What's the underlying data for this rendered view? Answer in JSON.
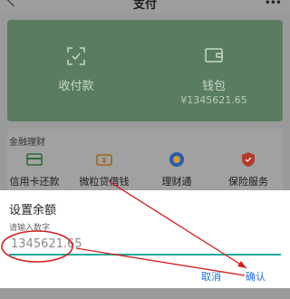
{
  "header": {
    "title": "支付"
  },
  "card": {
    "receive_label": "收付款",
    "wallet_label": "钱包",
    "wallet_amount": "¥1345621.65"
  },
  "finance": {
    "section_title": "金融理财",
    "items": [
      {
        "label": "信用卡还款",
        "icon": "credit-card-icon"
      },
      {
        "label": "微粒贷借钱",
        "icon": "loan-icon"
      },
      {
        "label": "理财通",
        "icon": "wealth-icon"
      },
      {
        "label": "保险服务",
        "icon": "insurance-icon"
      }
    ]
  },
  "dialog": {
    "title": "设置余额",
    "hint": "请输入数字",
    "input_value": "1345621.65",
    "cancel_label": "取消",
    "confirm_label": "确认"
  },
  "colors": {
    "card_green": "#5a7d5f",
    "accent_teal": "#1aa99b",
    "button_blue": "#1f6fd4",
    "annotation_red": "#d42020"
  }
}
